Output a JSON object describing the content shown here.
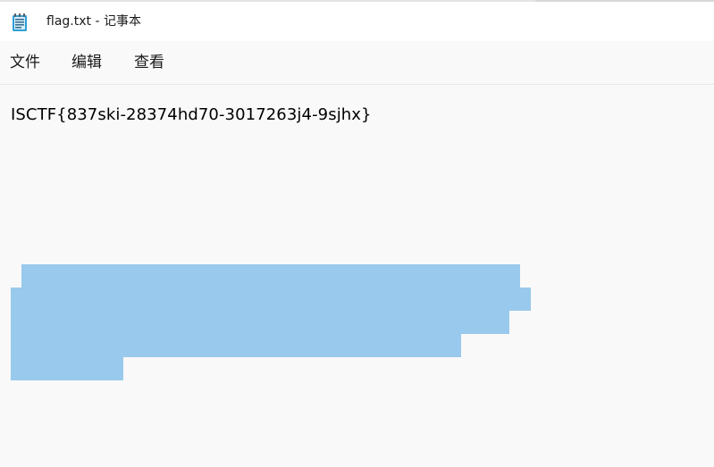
{
  "window": {
    "title": "flag.txt - 记事本",
    "app_icon": "notepad-icon"
  },
  "menu": {
    "items": [
      {
        "label": "文件"
      },
      {
        "label": "编辑"
      },
      {
        "label": "查看"
      }
    ]
  },
  "editor": {
    "content": "ISCTF{837ski-28374hd70-3017263j4-9sjhx}",
    "selection_color": "#99c9ec",
    "selected_lines": 5
  }
}
